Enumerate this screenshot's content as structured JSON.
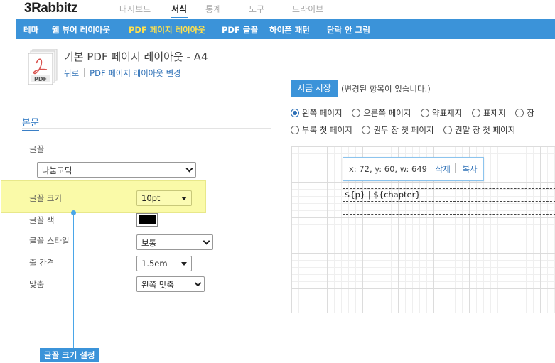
{
  "app": {
    "logo": "3Rabbitz",
    "top_nav": [
      {
        "label": "대시보드",
        "active": false
      },
      {
        "label": "서식",
        "active": true
      },
      {
        "label": "통계",
        "active": false
      },
      {
        "label": "도구",
        "active": false
      },
      {
        "label": "드라이브",
        "active": false
      }
    ],
    "menu": [
      {
        "label": "테마",
        "active": false
      },
      {
        "label": "웹 뷰어 레이아웃",
        "active": false
      },
      {
        "label": "PDF 페이지 레이아웃",
        "active": true
      },
      {
        "label": "PDF 글꼴",
        "active": false
      },
      {
        "label": "하이픈 패턴",
        "active": false
      },
      {
        "label": "단락 안 그림",
        "active": false
      }
    ]
  },
  "header": {
    "icon": "pdf-file-icon",
    "icon_text": "PDF",
    "title": "기본 PDF 페이지 레이아웃 - A4",
    "back_link": "뒤로",
    "change_link": "PDF 페이지 레이아웃 변경"
  },
  "form": {
    "section_title": "본문",
    "font_label": "글꼴",
    "font_value": "나눔고딕",
    "font_size_label": "글꼴 크기",
    "font_size_value": "10pt",
    "font_color_label": "글꼴 색",
    "font_color_value": "#000000",
    "font_style_label": "글꼴 스타일",
    "font_style_value": "보통",
    "line_spacing_label": "줄 간격",
    "line_spacing_value": "1.5em",
    "align_label": "맞춤",
    "align_value": "왼쪽 맞춤"
  },
  "callout": {
    "label": "글꼴 크기 설정",
    "color": "#3b93d9",
    "highlight_color": "#fafaa8"
  },
  "right": {
    "save_button": "지금 저장",
    "save_message": "(변경된 항목이 있습니다.)",
    "radios_row1": [
      {
        "label": "왼쪽 페이지",
        "checked": true
      },
      {
        "label": "오른쪽 페이지",
        "checked": false
      },
      {
        "label": "약표제지",
        "checked": false
      },
      {
        "label": "표제지",
        "checked": false
      },
      {
        "label": "장",
        "checked": false
      }
    ],
    "radios_row2": [
      {
        "label": "부록 첫 페이지",
        "checked": false
      },
      {
        "label": "권두 장 첫 페이지",
        "checked": false
      },
      {
        "label": "권말 장 첫 페이지",
        "checked": false
      }
    ],
    "tooltip": {
      "coords": "x: 72, y: 60, w: 649",
      "delete": "삭제",
      "copy": "복사"
    },
    "header_box_text": "${p}   |   ${chapter}"
  },
  "colors": {
    "accent": "#3b93d9",
    "active_menu": "#ffe14d",
    "link": "#2c6fb6"
  }
}
